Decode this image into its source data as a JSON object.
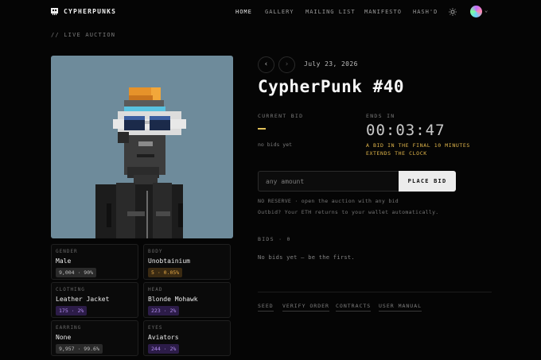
{
  "header": {
    "brand": "CYPHERPUNKS",
    "nav": [
      {
        "label": "HOME",
        "active": true
      },
      {
        "label": "GALLERY",
        "active": false
      },
      {
        "label": "MAILING LIST",
        "active": false
      },
      {
        "label": "MANIFESTO",
        "active": false
      },
      {
        "label": "HASH'D",
        "active": false
      }
    ],
    "theme_icon": "sun-icon",
    "account_icon": "chevron-down-icon"
  },
  "section_label": "// LIVE AUCTION",
  "traits": [
    {
      "label": "GENDER",
      "value": "Male",
      "badge": "9,004 · 90%",
      "badge_bg": "#2a2a2a",
      "badge_fg": "#bdbdbd"
    },
    {
      "label": "BODY",
      "value": "Unobtainium",
      "badge": "5 · 0.05%",
      "badge_bg": "#3a2a12",
      "badge_fg": "#e0a545"
    },
    {
      "label": "CLOTHING",
      "value": "Leather Jacket",
      "badge": "175 · 2%",
      "badge_bg": "#2c1c48",
      "badge_fg": "#b28cf0"
    },
    {
      "label": "HEAD",
      "value": "Blonde Mohawk",
      "badge": "223 · 2%",
      "badge_bg": "#2c1c48",
      "badge_fg": "#b28cf0"
    },
    {
      "label": "EARRING",
      "value": "None",
      "badge": "9,957 · 99.6%",
      "badge_bg": "#2a2a2a",
      "badge_fg": "#bdbdbd"
    },
    {
      "label": "EYES",
      "value": "Aviators",
      "badge": "244 · 2%",
      "badge_bg": "#2c1c48",
      "badge_fg": "#b28cf0"
    }
  ],
  "auction": {
    "prev_icon": "chevron-left-icon",
    "next_icon": "chevron-right-icon",
    "date": "July 23, 2026",
    "title": "CypherPunk #40",
    "current_bid_label": "CURRENT BID",
    "no_bids_yet": "no bids yet",
    "ends_in_label": "ENDS IN",
    "timer": "00:03:47",
    "extend_notice": "A BID IN THE FINAL 10 MINUTES EXTENDS THE CLOCK",
    "input_placeholder": "any amount",
    "place_bid": "PLACE BID",
    "reserve_note": "NO RESERVE · open the auction with any bid",
    "outbid_note": "Outbid? Your ETH returns to your wallet automatically.",
    "bids_label": "BIDS · 0",
    "no_bids_first": "No bids yet — be the first."
  },
  "footer_links": [
    "SEED",
    "VERIFY ORDER",
    "CONTRACTS",
    "USER MANUAL"
  ],
  "colors": {
    "accent_gold": "#e0b54a",
    "art_bg": "#6e8b9b"
  }
}
